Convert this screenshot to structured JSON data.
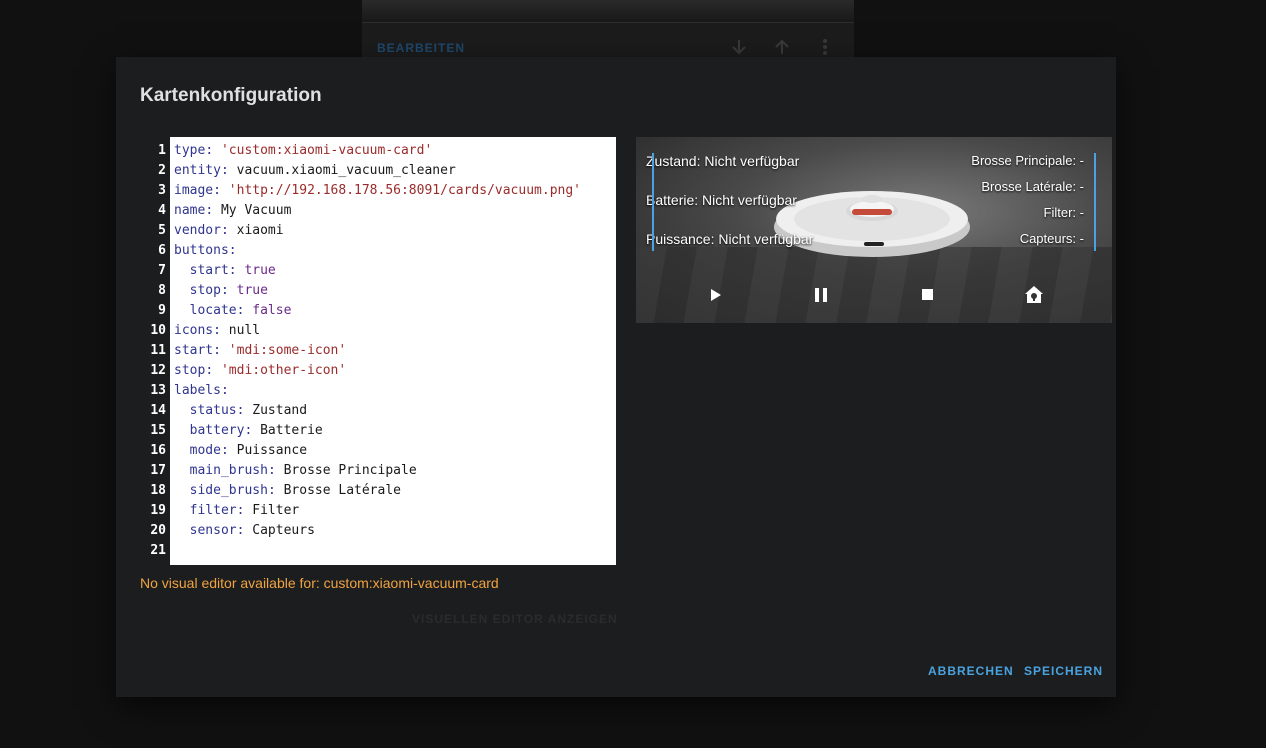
{
  "background_card": {
    "edit_label": "BEARBEITEN"
  },
  "dialog": {
    "title": "Kartenkonfiguration",
    "warning": "No visual editor available for: custom:xiaomi-vacuum-card",
    "show_visual_label": "VISUELLEN EDITOR ANZEIGEN",
    "cancel_label": "ABBRECHEN",
    "save_label": "SPEICHERN"
  },
  "yaml": {
    "lines": [
      {
        "n": "1",
        "indent": "",
        "key": "type",
        "val": "'custom:xiaomi-vacuum-card'",
        "vt": "s"
      },
      {
        "n": "2",
        "indent": "",
        "key": "entity",
        "val": "vacuum.xiaomi_vacuum_cleaner",
        "vt": "p"
      },
      {
        "n": "3",
        "indent": "",
        "key": "image",
        "val": "'http://192.168.178.56:8091/cards/vacuum.png'",
        "vt": "s"
      },
      {
        "n": "4",
        "indent": "",
        "key": "name",
        "val": "My Vacuum",
        "vt": "p"
      },
      {
        "n": "5",
        "indent": "",
        "key": "vendor",
        "val": "xiaomi",
        "vt": "p"
      },
      {
        "n": "6",
        "indent": "",
        "key": "buttons",
        "val": "",
        "vt": "p"
      },
      {
        "n": "7",
        "indent": "  ",
        "key": "start",
        "val": "true",
        "vt": "b"
      },
      {
        "n": "8",
        "indent": "  ",
        "key": "stop",
        "val": "true",
        "vt": "b"
      },
      {
        "n": "9",
        "indent": "  ",
        "key": "locate",
        "val": "false",
        "vt": "b"
      },
      {
        "n": "10",
        "indent": "",
        "key": "icons",
        "val": "null",
        "vt": "p"
      },
      {
        "n": "11",
        "indent": "",
        "key": "start",
        "val": "'mdi:some-icon'",
        "vt": "s"
      },
      {
        "n": "12",
        "indent": "",
        "key": "stop",
        "val": "'mdi:other-icon'",
        "vt": "s"
      },
      {
        "n": "13",
        "indent": "",
        "key": "labels",
        "val": "",
        "vt": "p"
      },
      {
        "n": "14",
        "indent": "  ",
        "key": "status",
        "val": "Zustand",
        "vt": "p"
      },
      {
        "n": "15",
        "indent": "  ",
        "key": "battery",
        "val": "Batterie",
        "vt": "p"
      },
      {
        "n": "16",
        "indent": "  ",
        "key": "mode",
        "val": "Puissance",
        "vt": "p"
      },
      {
        "n": "17",
        "indent": "  ",
        "key": "main_brush",
        "val": "Brosse Principale",
        "vt": "p"
      },
      {
        "n": "18",
        "indent": "  ",
        "key": "side_brush",
        "val": "Brosse Latérale",
        "vt": "p"
      },
      {
        "n": "19",
        "indent": "  ",
        "key": "filter",
        "val": "Filter",
        "vt": "p"
      },
      {
        "n": "20",
        "indent": "  ",
        "key": "sensor",
        "val": "Capteurs",
        "vt": "p"
      },
      {
        "n": "21",
        "indent": "",
        "key": "",
        "val": "",
        "vt": "p"
      }
    ]
  },
  "vacuum_card": {
    "left_stats": [
      "Zustand: Nicht verfügbar",
      "Batterie: Nicht verfügbar",
      "Puissance: Nicht verfügbar"
    ],
    "right_stats": [
      "Brosse Principale: -",
      "Brosse Latérale: -",
      "Filter: -",
      "Capteurs: -"
    ],
    "controls": [
      "play-icon",
      "pause-icon",
      "stop-icon",
      "home-locate-icon"
    ]
  },
  "colors": {
    "accent": "#4aa3df",
    "warning": "#f0a340",
    "dialog_bg": "#1c1d1f",
    "yaml_key": "#2f3590",
    "yaml_string": "#9b2b2b",
    "yaml_bool": "#6a2a8a"
  }
}
